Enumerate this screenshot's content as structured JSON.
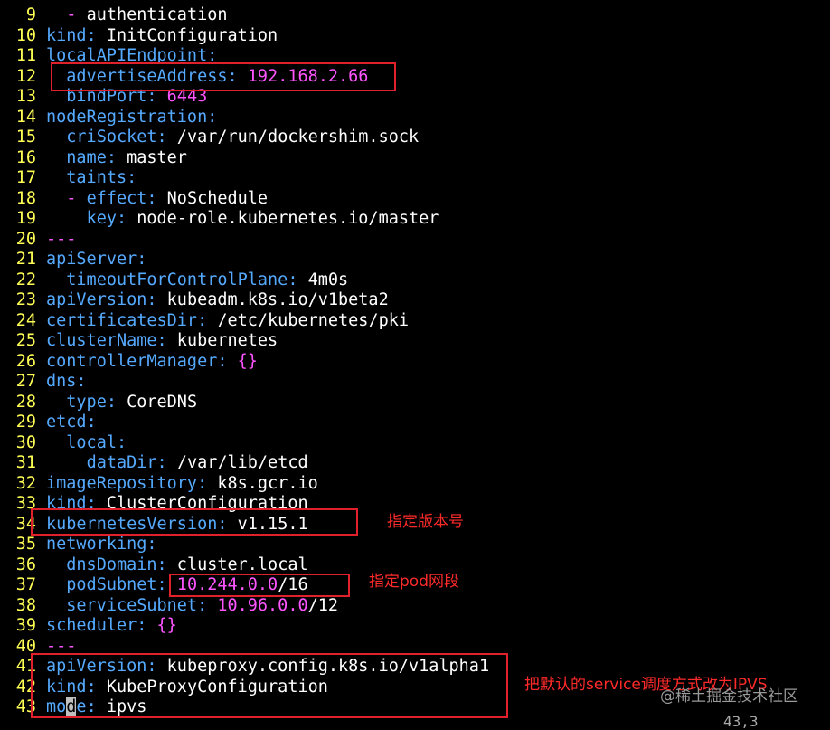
{
  "editor": {
    "lines": [
      {
        "n": "9",
        "indent": "  ",
        "dash": "- ",
        "key": "",
        "colon": "",
        "val": "authentication"
      },
      {
        "n": "10",
        "indent": "",
        "dash": "",
        "key": "kind",
        "colon": ":",
        "val": " InitConfiguration"
      },
      {
        "n": "11",
        "indent": "",
        "dash": "",
        "key": "localAPIEndpoint",
        "colon": ":",
        "val": ""
      },
      {
        "n": "12",
        "indent": "  ",
        "dash": "",
        "key": "advertiseAddress",
        "colon": ":",
        "num": " 192.168.2.66",
        "val": ""
      },
      {
        "n": "13",
        "indent": "  ",
        "dash": "",
        "key": "bindPort",
        "colon": ":",
        "num": " 6443",
        "val": ""
      },
      {
        "n": "14",
        "indent": "",
        "dash": "",
        "key": "nodeRegistration",
        "colon": ":",
        "val": ""
      },
      {
        "n": "15",
        "indent": "  ",
        "dash": "",
        "key": "criSocket",
        "colon": ":",
        "val": " /var/run/dockershim.sock"
      },
      {
        "n": "16",
        "indent": "  ",
        "dash": "",
        "key": "name",
        "colon": ":",
        "val": " master"
      },
      {
        "n": "17",
        "indent": "  ",
        "dash": "",
        "key": "taints",
        "colon": ":",
        "val": ""
      },
      {
        "n": "18",
        "indent": "  ",
        "dash": "- ",
        "key": "effect",
        "colon": ":",
        "val": " NoSchedule"
      },
      {
        "n": "19",
        "indent": "    ",
        "dash": "",
        "key": "key",
        "colon": ":",
        "val": " node-role.kubernetes.io/master"
      },
      {
        "n": "20",
        "indent": "",
        "dash": "",
        "key": "",
        "colon": "",
        "val": "",
        "sep": "---"
      },
      {
        "n": "21",
        "indent": "",
        "dash": "",
        "key": "apiServer",
        "colon": ":",
        "val": ""
      },
      {
        "n": "22",
        "indent": "  ",
        "dash": "",
        "key": "timeoutForControlPlane",
        "colon": ":",
        "val": " 4m0s"
      },
      {
        "n": "23",
        "indent": "",
        "dash": "",
        "key": "apiVersion",
        "colon": ":",
        "val": " kubeadm.k8s.io/v1beta2"
      },
      {
        "n": "24",
        "indent": "",
        "dash": "",
        "key": "certificatesDir",
        "colon": ":",
        "val": " /etc/kubernetes/pki"
      },
      {
        "n": "25",
        "indent": "",
        "dash": "",
        "key": "clusterName",
        "colon": ":",
        "val": " kubernetes"
      },
      {
        "n": "26",
        "indent": "",
        "dash": "",
        "key": "controllerManager",
        "colon": ":",
        "brace": " {}",
        "val": ""
      },
      {
        "n": "27",
        "indent": "",
        "dash": "",
        "key": "dns",
        "colon": ":",
        "val": ""
      },
      {
        "n": "28",
        "indent": "  ",
        "dash": "",
        "key": "type",
        "colon": ":",
        "val": " CoreDNS"
      },
      {
        "n": "29",
        "indent": "",
        "dash": "",
        "key": "etcd",
        "colon": ":",
        "val": ""
      },
      {
        "n": "30",
        "indent": "  ",
        "dash": "",
        "key": "local",
        "colon": ":",
        "val": ""
      },
      {
        "n": "31",
        "indent": "    ",
        "dash": "",
        "key": "dataDir",
        "colon": ":",
        "val": " /var/lib/etcd"
      },
      {
        "n": "32",
        "indent": "",
        "dash": "",
        "key": "imageRepository",
        "colon": ":",
        "val": " k8s.gcr.io"
      },
      {
        "n": "33",
        "indent": "",
        "dash": "",
        "key": "kind",
        "colon": ":",
        "val": " ClusterConfiguration"
      },
      {
        "n": "34",
        "indent": "",
        "dash": "",
        "key": "kubernetesVersion",
        "colon": ":",
        "val": " v1.15.1"
      },
      {
        "n": "35",
        "indent": "",
        "dash": "",
        "key": "networking",
        "colon": ":",
        "val": ""
      },
      {
        "n": "36",
        "indent": "  ",
        "dash": "",
        "key": "dnsDomain",
        "colon": ":",
        "val": " cluster.local"
      },
      {
        "n": "37",
        "indent": "  ",
        "dash": "",
        "key": "podSubnet",
        "colon": ":",
        "num": " 10.244.0.0",
        "val": "/16"
      },
      {
        "n": "38",
        "indent": "  ",
        "dash": "",
        "key": "serviceSubnet",
        "colon": ":",
        "num": " 10.96.0.0",
        "val": "/12"
      },
      {
        "n": "39",
        "indent": "",
        "dash": "",
        "key": "scheduler",
        "colon": ":",
        "brace": " {}",
        "val": ""
      },
      {
        "n": "40",
        "indent": "",
        "dash": "",
        "key": "",
        "colon": "",
        "val": "",
        "sep": "---"
      },
      {
        "n": "41",
        "indent": "",
        "dash": "",
        "key": "apiVersion",
        "colon": ":",
        "val": " kubeproxy.config.k8s.io/v1alpha1"
      },
      {
        "n": "42",
        "indent": "",
        "dash": "",
        "key": "kind",
        "colon": ":",
        "val": " KubeProxyConfiguration"
      },
      {
        "n": "43",
        "indent": "",
        "dash": "",
        "key": "mode",
        "colon": ":",
        "val": " ipvs",
        "cursor_at": 2
      }
    ]
  },
  "annotations": {
    "version_note": "指定版本号",
    "pod_note": "指定pod网段",
    "ipvs_note": "把默认的service调度方式改为IPVS"
  },
  "watermark": "@稀土掘金技术社区",
  "status_fragment": "43,3",
  "colors": {
    "background": "#000000",
    "line_number": "#ffff55",
    "key": "#55aaff",
    "number": "#ff55ff",
    "highlight_box": "#e0202a",
    "annotation_text": "#ff2a2a"
  }
}
